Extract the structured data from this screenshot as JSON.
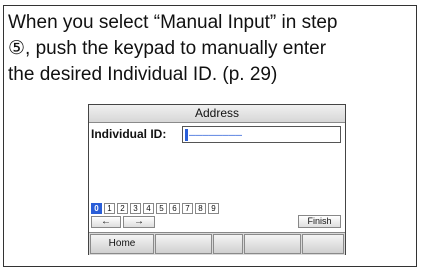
{
  "instruction": {
    "line1": "When you select “Manual Input” in step",
    "line2": "⑤, push the keypad to manually enter",
    "line3": "the desired Individual ID. (p. 29)"
  },
  "screen": {
    "title": "Address",
    "id_label": "Individual ID:",
    "id_value": "––––––––",
    "keypad": [
      "0",
      "1",
      "2",
      "3",
      "4",
      "5",
      "6",
      "7",
      "8",
      "9"
    ],
    "selected_key": "0",
    "left_arrow": "←",
    "right_arrow": "→",
    "finish_label": "Finish",
    "function_keys": [
      "Home",
      "",
      "",
      "",
      ""
    ]
  }
}
